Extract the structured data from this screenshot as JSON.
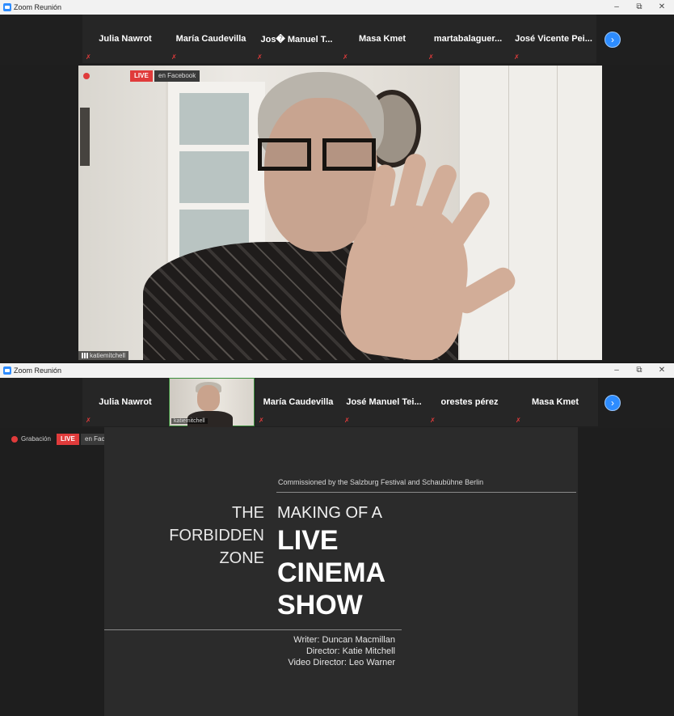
{
  "window1": {
    "title": "Zoom Reunión",
    "controls": {
      "minimize": "–",
      "restore": "⧉",
      "close": "✕"
    },
    "participants": [
      {
        "name": "Julia Nawrot"
      },
      {
        "name": "María Caudevilla"
      },
      {
        "name": "Jos� Manuel T..."
      },
      {
        "name": "Masa Kmet"
      },
      {
        "name": "martabalaguer..."
      },
      {
        "name": "José Vicente Pei..."
      }
    ],
    "next_icon": "›",
    "live_badge": "LIVE",
    "live_target": "en Facebook",
    "speaker_label": "katiemitchell"
  },
  "window2": {
    "title": "Zoom Reunión",
    "controls": {
      "minimize": "–",
      "restore": "⧉",
      "close": "✕"
    },
    "video_tile_label": "katiemitchell",
    "participants": [
      {
        "name": "Julia Nawrot"
      },
      {
        "name": "María Caudevilla"
      },
      {
        "name": "José Manuel Tei..."
      },
      {
        "name": "orestes pérez"
      },
      {
        "name": "Masa Kmet"
      }
    ],
    "next_icon": "›",
    "recording_label": "Grabación",
    "live_badge": "LIVE",
    "live_target": "en Facebook",
    "slide": {
      "commissioned": "Commissioned by the Salzburg Festival and Schaubühne Berlin",
      "left_title": [
        "THE",
        "FORBIDDEN",
        "ZONE"
      ],
      "making_of": "MAKING OF A",
      "big_title": [
        "LIVE",
        "CINEMA",
        "SHOW"
      ],
      "credits": [
        "Writer: Duncan Macmillan",
        "Director: Katie Mitchell",
        "Video Director: Leo Warner"
      ]
    }
  },
  "colors": {
    "zoom_blue": "#2d8cff",
    "live_red": "#e03b3b",
    "background": "#1e1e1e"
  },
  "icons": {
    "mute": "mic-muted-icon",
    "next": "chevron-right-icon",
    "record": "record-dot-icon"
  }
}
